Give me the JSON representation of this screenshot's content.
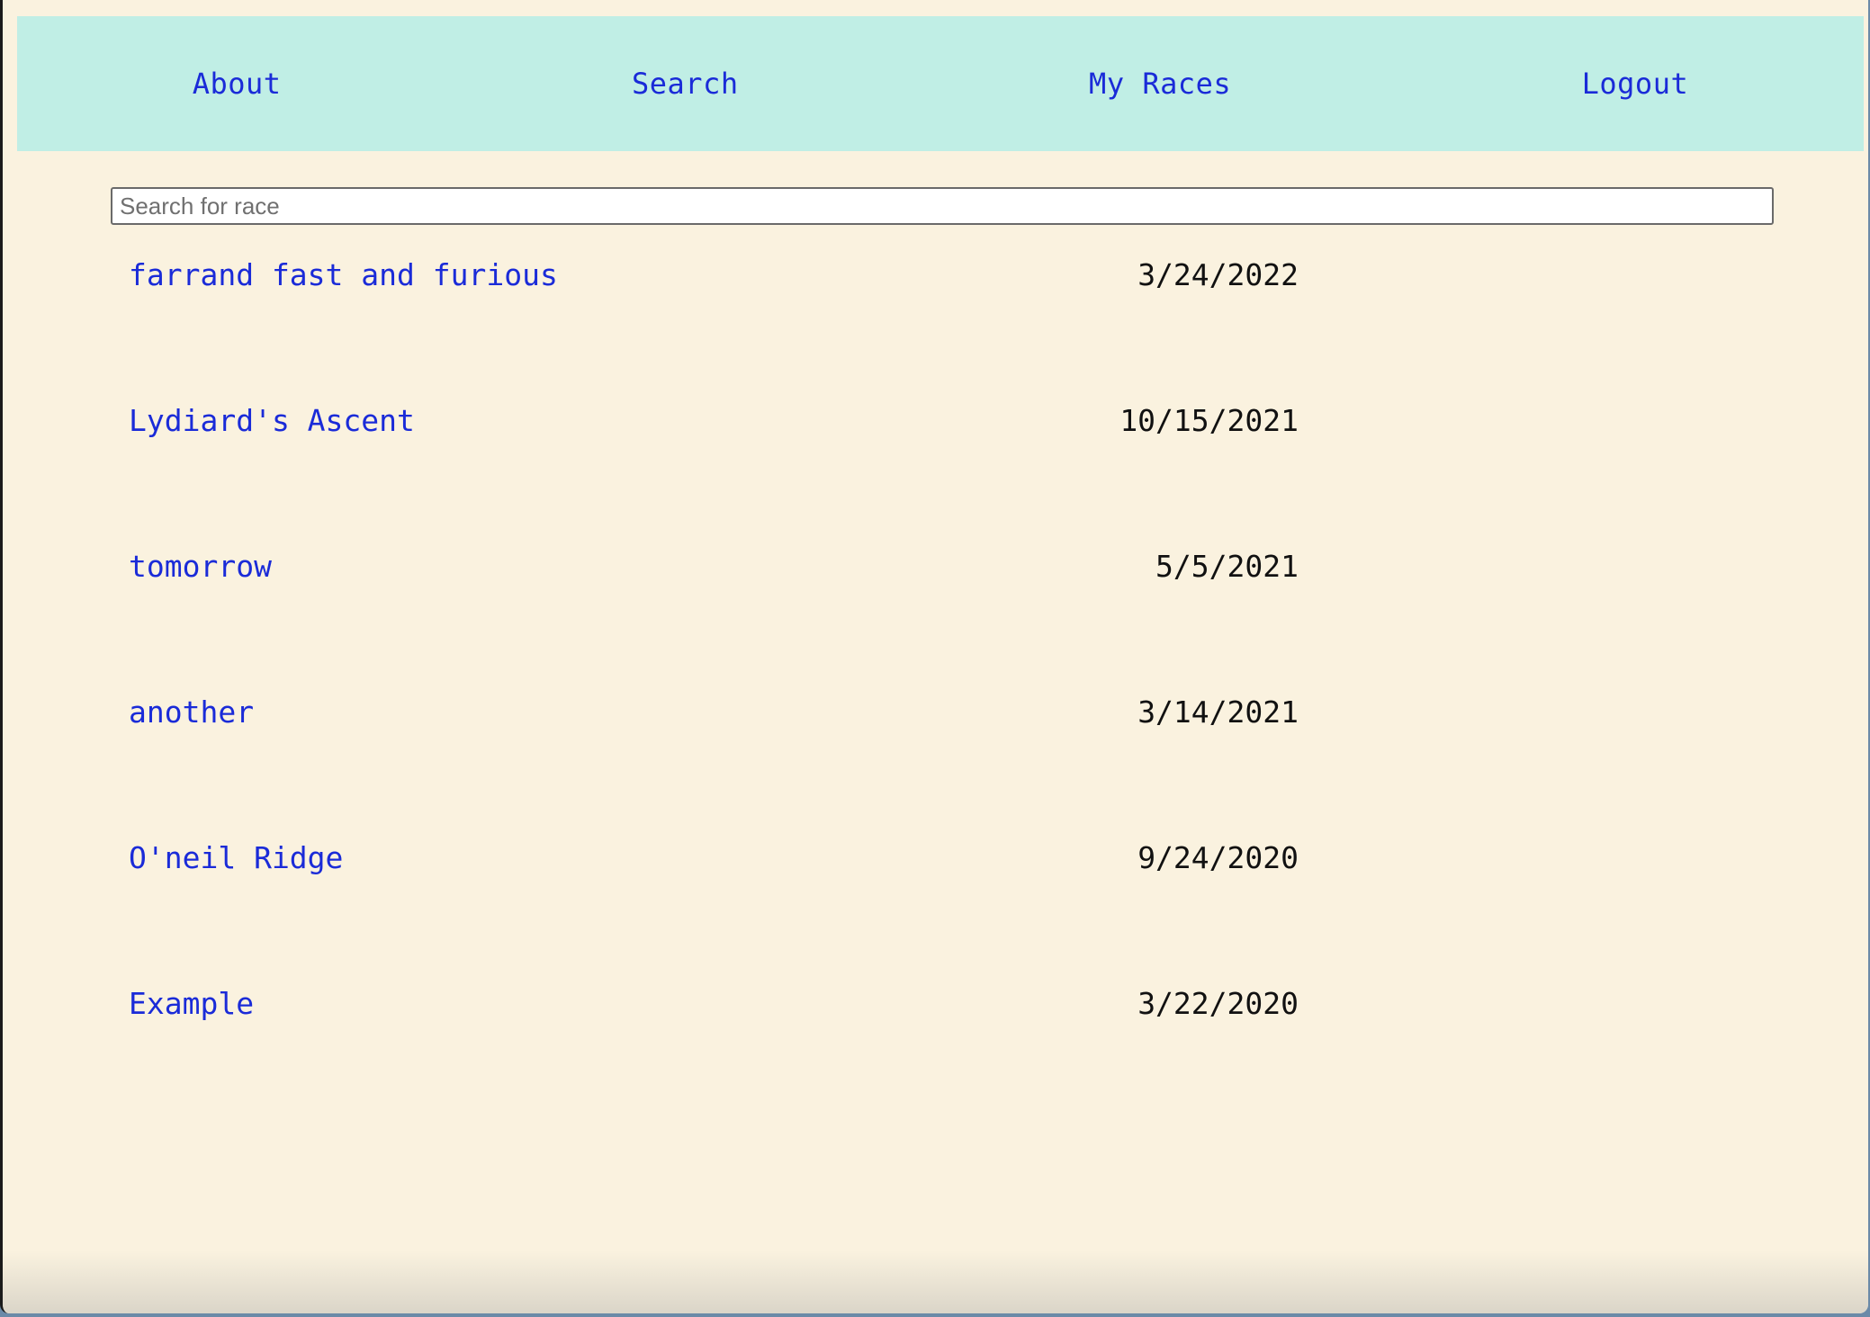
{
  "nav": {
    "items": [
      {
        "label": "About"
      },
      {
        "label": "Search"
      },
      {
        "label": "My Races"
      },
      {
        "label": "Logout"
      }
    ]
  },
  "search": {
    "placeholder": "Search for race",
    "value": ""
  },
  "races": [
    {
      "name": "farrand fast and furious",
      "date": "3/24/2022"
    },
    {
      "name": "Lydiard's Ascent",
      "date": "10/15/2021"
    },
    {
      "name": "tomorrow",
      "date": "5/5/2021"
    },
    {
      "name": "another",
      "date": "3/14/2021"
    },
    {
      "name": "O'neil Ridge",
      "date": "9/24/2020"
    },
    {
      "name": "Example",
      "date": "3/22/2020"
    }
  ],
  "colors": {
    "background": "#faf2df",
    "navbar": "#c0eee5",
    "link": "#1a2bd8",
    "text": "#111111"
  }
}
